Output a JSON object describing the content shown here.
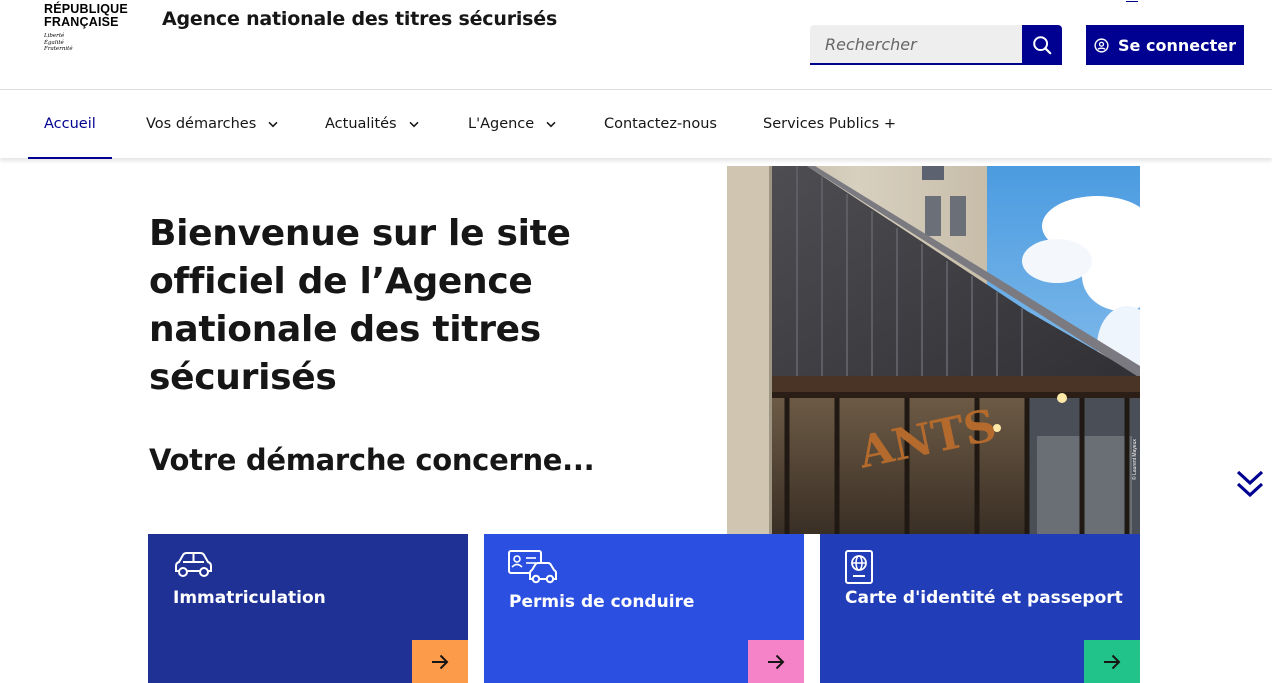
{
  "header": {
    "logo_line1": "RÉPUBLIQUE",
    "logo_line2": "FRANÇAISE",
    "motto": [
      "Liberté",
      "Égalité",
      "Fraternité"
    ],
    "site_title": "Agence nationale des titres sécurisés",
    "search_placeholder": "Rechercher",
    "search_icon": "search-icon",
    "login_label": "Se connecter",
    "login_icon": "user-circle-icon"
  },
  "nav": {
    "items": [
      {
        "label": "Accueil",
        "active": true
      },
      {
        "label": "Vos démarches",
        "dropdown": true
      },
      {
        "label": "Actualités",
        "dropdown": true
      },
      {
        "label": "L'Agence",
        "dropdown": true
      },
      {
        "label": "Contactez-nous"
      },
      {
        "label": "Services Publics +"
      }
    ]
  },
  "hero": {
    "title": "Bienvenue sur le site officiel de l’Agence nationale des titres sécurisés",
    "subtitle": "Votre démarche concerne...",
    "photo_text": "ANTS",
    "photo_credit": "© Laurent Mayeux"
  },
  "cards": [
    {
      "label": "Immatriculation",
      "icon": "car-icon",
      "bg": "#1f3195",
      "arrow_bg": "#fc9c4a"
    },
    {
      "label": "Permis de conduire",
      "icon": "driving-license-icon",
      "bg": "#2b4fe0",
      "arrow_bg": "#f583c7"
    },
    {
      "label": "Carte d'identité et passeport",
      "icon": "passport-icon",
      "bg": "#223db8",
      "arrow_bg": "#21c38b"
    }
  ],
  "colors": {
    "primary": "#000091",
    "text": "#161616",
    "search_bg": "#eeeeee"
  }
}
